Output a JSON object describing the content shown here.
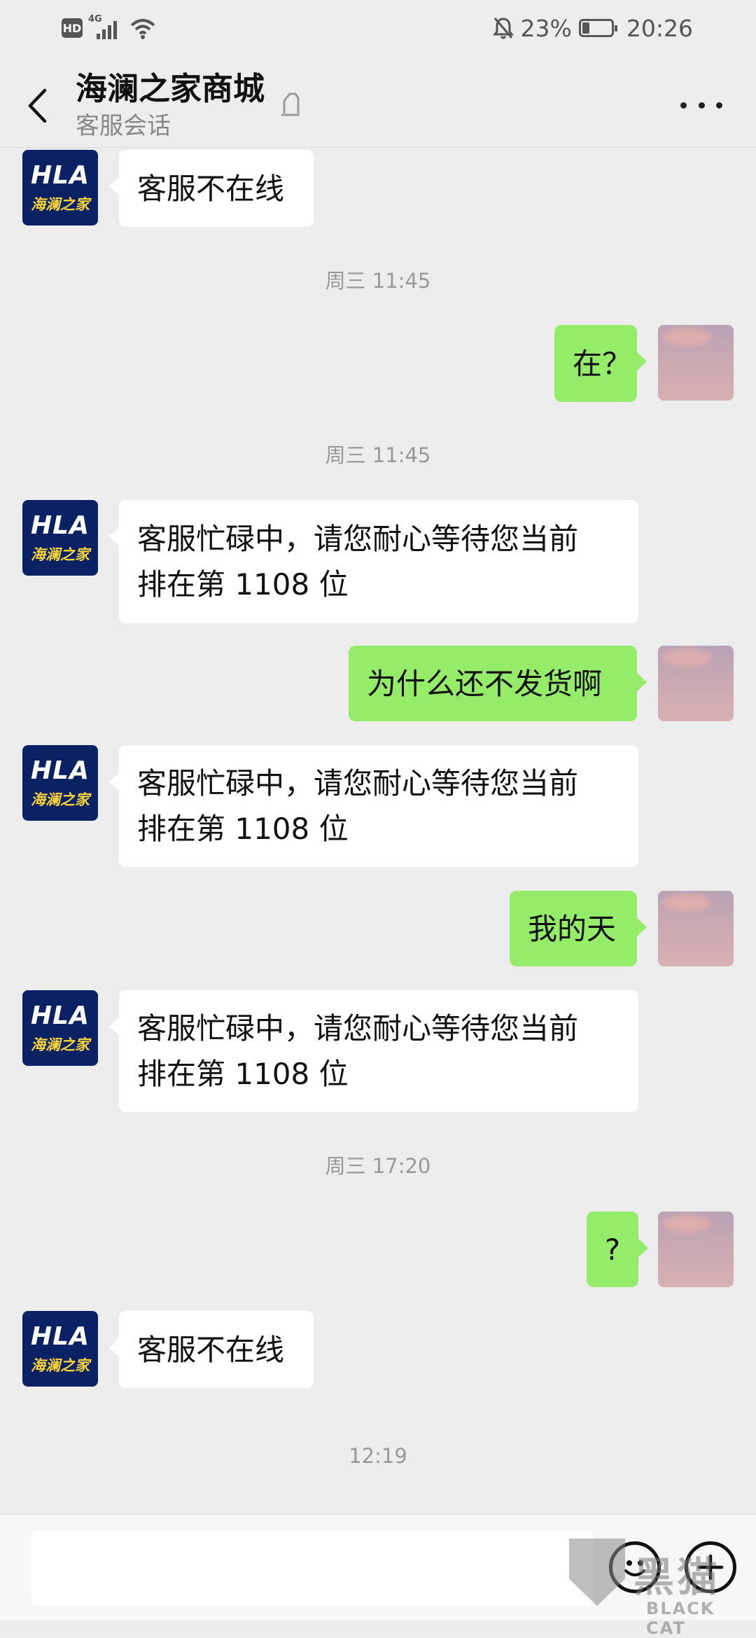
{
  "status_bar": {
    "hd": "HD",
    "network": "4G",
    "battery": "23%",
    "time": "20:26"
  },
  "header": {
    "title": "海澜之家商城",
    "subtitle": "客服会话"
  },
  "shop_avatar": {
    "logo_text": "HLA",
    "logo_cn": "海澜之家"
  },
  "messages": [
    {
      "text": "客服不在线"
    },
    {
      "time": "周三 11:45"
    },
    {
      "text": "在？"
    },
    {
      "time": "周三 11:45"
    },
    {
      "line1": "客服忙碌中，请您耐心等待您当前",
      "line2": "排在第 1108 位"
    },
    {
      "text": "为什么还不发货啊"
    },
    {
      "line1": "客服忙碌中，请您耐心等待您当前",
      "line2": "排在第 1108 位"
    },
    {
      "text": "我的天"
    },
    {
      "line1": "客服忙碌中，请您耐心等待您当前",
      "line2": "排在第 1108 位"
    },
    {
      "time": "周三 17:20"
    },
    {
      "text": "?"
    },
    {
      "text": "客服不在线"
    },
    {
      "time": "12:19"
    }
  ],
  "input": {
    "placeholder": ""
  },
  "watermark": {
    "cn": "黑猫",
    "en": "BLACK CAT"
  },
  "colors": {
    "background": "#ededed",
    "outgoing_bubble": "#95ec69",
    "incoming_bubble": "#ffffff",
    "shop_logo": "#0a2264"
  }
}
